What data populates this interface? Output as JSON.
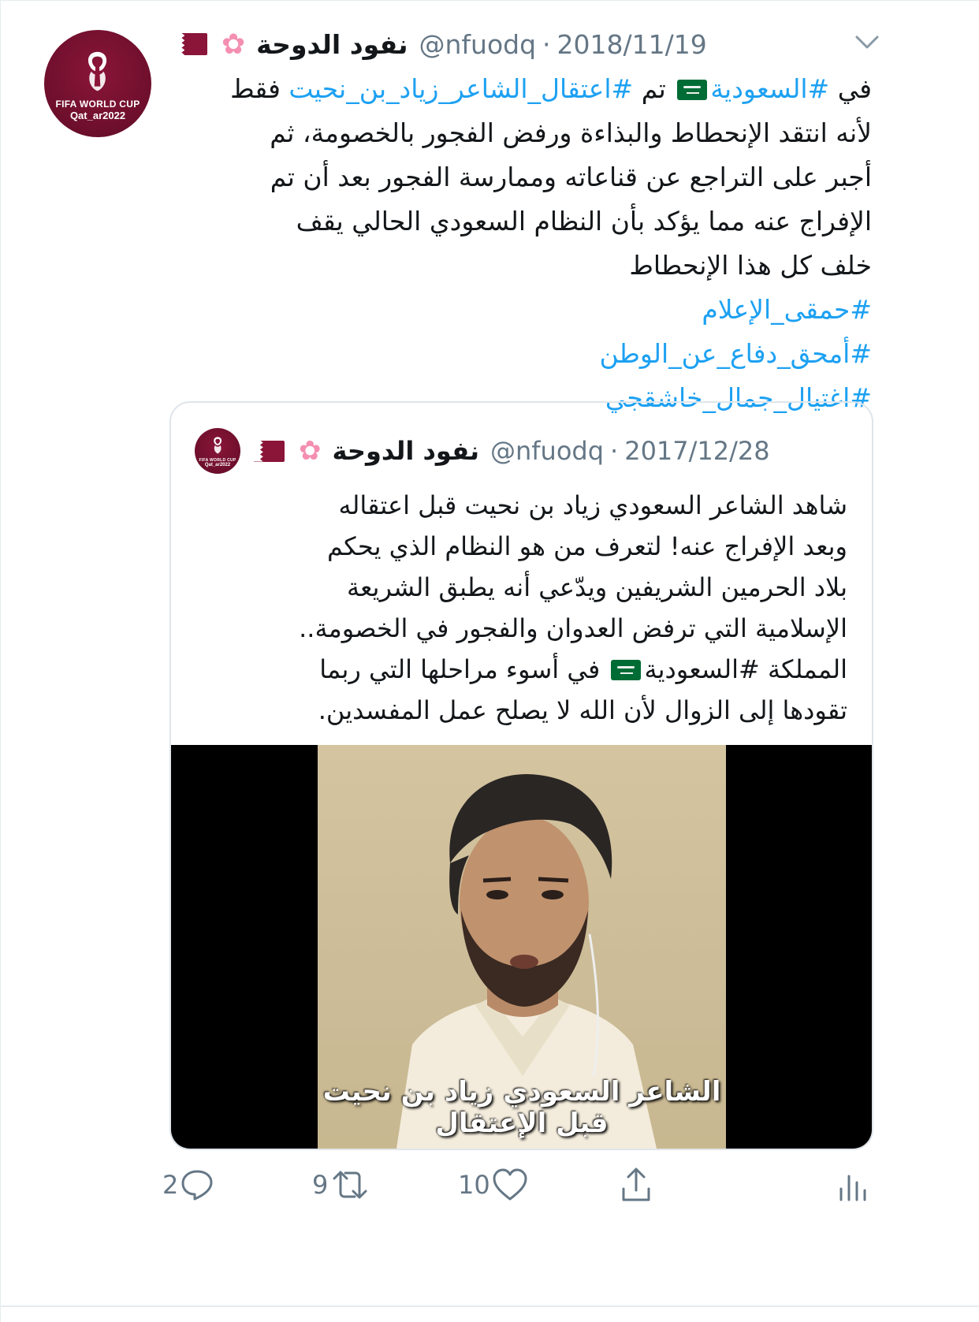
{
  "tweet": {
    "display_name": "نفود الدوحة",
    "handle": "@nfuodq",
    "separator": "·",
    "date": "2018/11/19",
    "text_lines": [
      [
        {
          "t": "في ",
          "type": "text"
        },
        {
          "t": "#السعودية",
          "type": "link"
        },
        {
          "t": "",
          "type": "flag-sa"
        },
        {
          "t": " تم ",
          "type": "text"
        },
        {
          "t": "#اعتقال_الشاعر_زياد_بن_نحيت",
          "type": "link"
        },
        {
          "t": " فقط",
          "type": "text"
        }
      ],
      "لأنه انتقد الإنحطاط والبذاءة ورفض الفجور بالخصومة، ثم",
      "أجبر على التراجع عن قناعاته وممارسة الفجور بعد أن تم",
      "الإفراج عنه مما يؤكد بأن النظام السعودي الحالي يقف",
      "خلف كل هذا الإنحطاط"
    ],
    "hashtags": [
      "#حمقى_الإعلام",
      "#أمحق_دفاع_عن_الوطن",
      "#اغتيال_جمال_خاشقجي"
    ]
  },
  "avatar": {
    "line1": "FIFA WORLD CUP",
    "line2": "Qat_ar2022"
  },
  "quoted": {
    "display_name": "نفود الدوحة",
    "handle": "@nfuodq",
    "separator": "·",
    "date": "2017/12/28",
    "text_lines": [
      "شاهد الشاعر السعودي زياد بن نحيت قبل اعتقاله",
      "وبعد الإفراج عنه! لتعرف من هو النظام الذي يحكم",
      "بلاد الحرمين الشريفين ويدّعي أنه يطبق الشريعة",
      "الإسلامية التي ترفض العدوان والفجور في الخصومة..",
      [
        {
          "t": "المملكة #السعودية",
          "type": "text"
        },
        {
          "t": "",
          "type": "flag-sa"
        },
        {
          "t": " في أسوء مراحلها التي ربما",
          "type": "text"
        }
      ],
      "تقودها إلى الزوال لأن الله لا يصلح عمل المفسدين."
    ],
    "video_subtitle": "الشاعر السعودي زياد بن نحيت قبل الإعتقال"
  },
  "actions": {
    "reply_count": "2",
    "retweet_count": "9",
    "like_count": "10"
  },
  "colors": {
    "link": "#1da1f2",
    "meta": "#657786",
    "avatar": "#8a1538",
    "border": "#dfe5ea"
  },
  "icons": [
    "chevron-down-icon",
    "qatar-flag-icon",
    "cherry-blossom-icon",
    "saudi-flag-icon",
    "reply-icon",
    "retweet-icon",
    "like-icon",
    "share-icon",
    "analytics-icon"
  ]
}
